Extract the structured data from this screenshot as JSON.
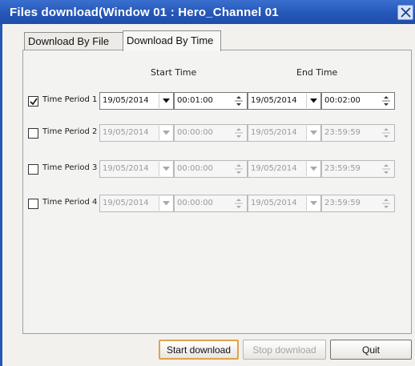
{
  "window": {
    "title": "Files download(Window 01 : Hero_Channel  01"
  },
  "tabs": [
    {
      "label": "Download By File",
      "active": false
    },
    {
      "label": "Download By Time",
      "active": true
    }
  ],
  "headers": {
    "start": "Start Time",
    "end": "End Time"
  },
  "periods": [
    {
      "label": "Time Period 1",
      "checked": true,
      "start_date": "19/05/2014",
      "start_time": "00:01:00",
      "end_date": "19/05/2014",
      "end_time": "00:02:00"
    },
    {
      "label": "Time Period 2",
      "checked": false,
      "start_date": "19/05/2014",
      "start_time": "00:00:00",
      "end_date": "19/05/2014",
      "end_time": "23:59:59"
    },
    {
      "label": "Time Period 3",
      "checked": false,
      "start_date": "19/05/2014",
      "start_time": "00:00:00",
      "end_date": "19/05/2014",
      "end_time": "23:59:59"
    },
    {
      "label": "Time Period 4",
      "checked": false,
      "start_date": "19/05/2014",
      "start_time": "00:00:00",
      "end_date": "19/05/2014",
      "end_time": "23:59:59"
    }
  ],
  "buttons": {
    "start": "Start download",
    "stop": "Stop download",
    "quit": "Quit"
  },
  "icons": {
    "close": "close-icon",
    "check": "checkmark-icon",
    "dropdown": "chevron-down-icon",
    "spinner": "spinner-arrows-icon"
  },
  "colors": {
    "titlebar": "#2557b8",
    "title_text": "#ffffff",
    "default_button_border": "#e0a24a",
    "disabled_text": "#9a9a9a"
  }
}
